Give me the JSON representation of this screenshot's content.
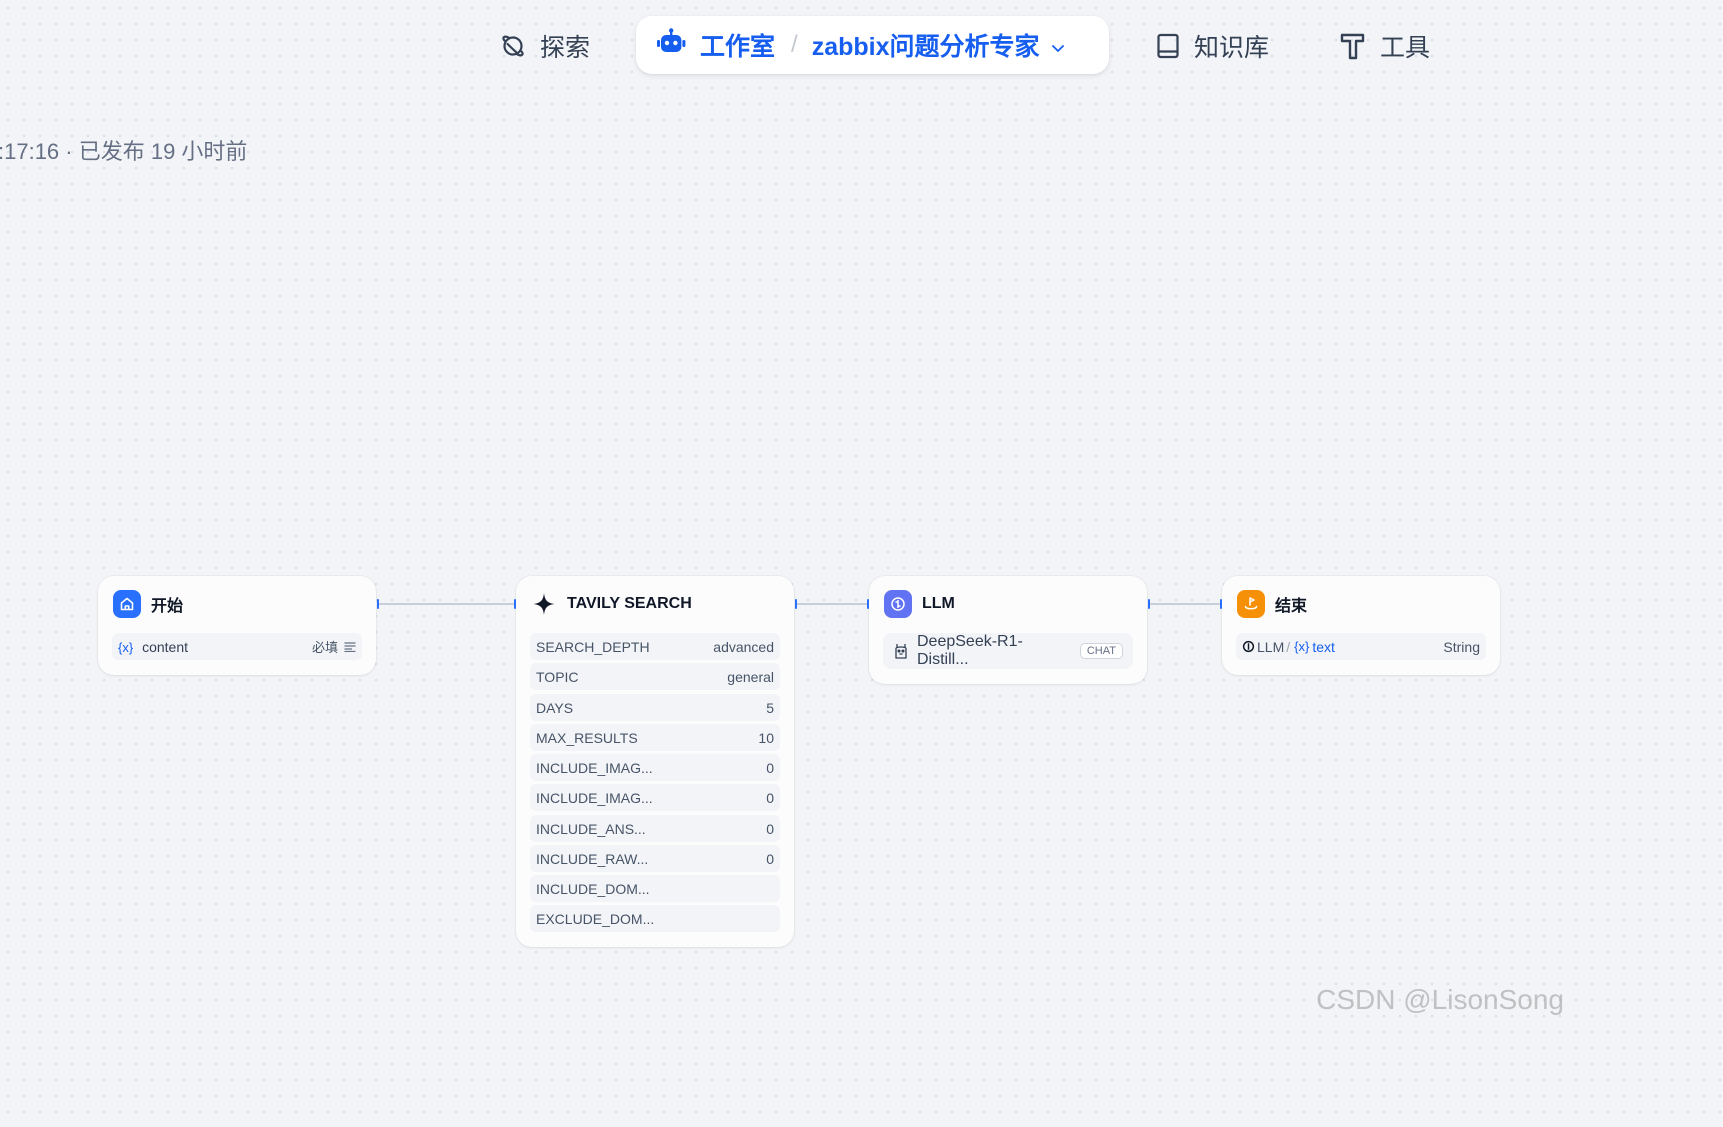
{
  "nav": {
    "explore_label": "探索",
    "studio_label": "工作室",
    "app_name": "zabbix问题分析专家",
    "knowledge_label": "知识库",
    "tools_label": "工具"
  },
  "publish_info": ":17:16 · 已发布 19 小时前",
  "nodes": {
    "start": {
      "title": "开始",
      "var_symbol": "{x}",
      "var_name": "content",
      "required_label": "必填"
    },
    "tavily": {
      "title": "TAVILY SEARCH",
      "params": [
        {
          "key": "SEARCH_DEPTH",
          "value": "advanced"
        },
        {
          "key": "TOPIC",
          "value": "general"
        },
        {
          "key": "DAYS",
          "value": "5"
        },
        {
          "key": "MAX_RESULTS",
          "value": "10"
        },
        {
          "key": "INCLUDE_IMAG...",
          "value": "0"
        },
        {
          "key": "INCLUDE_IMAG...",
          "value": "0"
        },
        {
          "key": "INCLUDE_ANS...",
          "value": "0"
        },
        {
          "key": "INCLUDE_RAW...",
          "value": "0"
        },
        {
          "key": "INCLUDE_DOM...",
          "value": ""
        },
        {
          "key": "EXCLUDE_DOM...",
          "value": ""
        }
      ]
    },
    "llm": {
      "title": "LLM",
      "model": "DeepSeek-R1-Distill...",
      "mode_badge": "CHAT"
    },
    "end": {
      "title": "结束",
      "source_node": "LLM",
      "slash": "/",
      "var_symbol": "{x}",
      "var_name": "text",
      "type": "String"
    }
  },
  "watermark": "CSDN @LisonSong",
  "colors": {
    "accent": "#155eef",
    "start_icon": "#2970ff",
    "llm_icon": "#6172f3",
    "end_icon": "#f79009"
  }
}
